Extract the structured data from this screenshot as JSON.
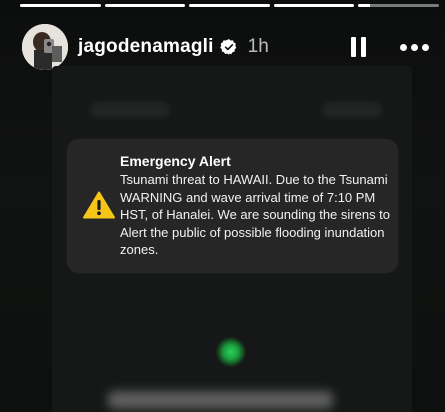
{
  "story": {
    "progress": [
      1,
      1,
      1,
      1,
      0.15
    ]
  },
  "header": {
    "username": "jagodenamagli",
    "time": "1h",
    "verified_icon": "verified-badge-icon",
    "pause_icon": "pause-icon",
    "more_icon": "more-options-icon"
  },
  "alert": {
    "title": "Emergency Alert",
    "body": "Tsunami threat to HAWAII. Due to the Tsunami WARNING and wave arrival time of 7:10 PM HST, of Hanalei. We are sounding the sirens to Alert the public of possible flooding inundation zones.",
    "icon": "warning-triangle-icon",
    "icon_color": "#F5C518"
  },
  "colors": {
    "background": "#111312",
    "alert_card": "#262626",
    "glow_dot": "#28DC5A"
  }
}
